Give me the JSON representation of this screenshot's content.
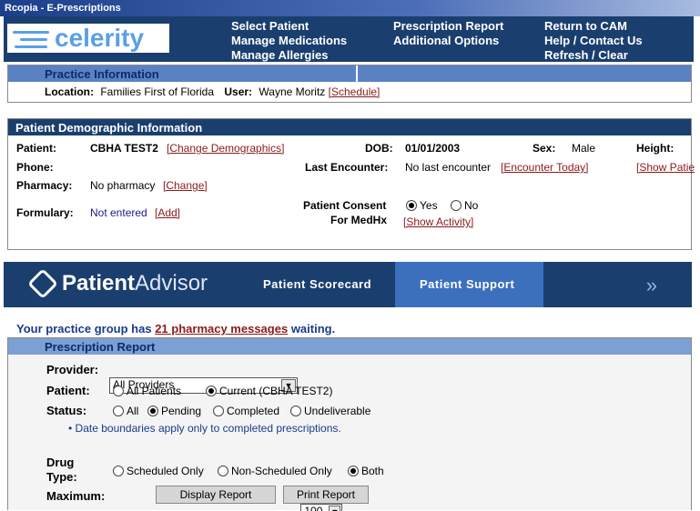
{
  "window": {
    "title": "Rcopia - E-Prescriptions"
  },
  "header": {
    "logo": "celerity",
    "nav": {
      "col1": [
        "Select Patient",
        "Manage Medications",
        "Manage Allergies"
      ],
      "col2": [
        "Prescription Report",
        "Additional Options"
      ],
      "col3": [
        "Return to CAM",
        "Help / Contact Us",
        "Refresh / Clear"
      ]
    }
  },
  "practice": {
    "heading": "Practice Information",
    "location_label": "Location:",
    "location": "Families First of Florida",
    "user_label": "User:",
    "user": "Wayne Moritz",
    "schedule_link": "[Schedule]"
  },
  "patient_demo": {
    "heading": "Patient Demographic Information",
    "patient_label": "Patient:",
    "patient": "CBHA TEST2",
    "change_demo_link": "[Change Demographics]",
    "dob_label": "DOB:",
    "dob": "01/01/2003",
    "sex_label": "Sex:",
    "sex": "Male",
    "height_label": "Height:",
    "phone_label": "Phone:",
    "last_enc_label": "Last Encounter:",
    "last_enc": "No last encounter",
    "enc_today_link": "[Encounter Today]",
    "show_patient_link": "[Show Patie",
    "pharmacy_label": "Pharmacy:",
    "pharmacy": "No pharmacy",
    "change_pharmacy_link": "[Change]",
    "consent_label_1": "Patient Consent",
    "consent_label_2": "For MedHx",
    "consent_yes": "Yes",
    "consent_no": "No",
    "show_activity_link": "[Show Activity]",
    "formulary_label": "Formulary:",
    "formulary": "Not entered",
    "add_link": "[Add]"
  },
  "patient_advisor": {
    "logo_bold": "Patient",
    "logo_light": "Advisor",
    "scorecard": "Patient Scorecard",
    "support": "Patient Support",
    "more": "»"
  },
  "messages": {
    "prefix": "Your practice group has",
    "link": "21 pharmacy messages",
    "suffix": "waiting."
  },
  "report": {
    "heading": "Prescription Report",
    "provider_label": "Provider:",
    "provider_value": "All Providers",
    "patient_label": "Patient:",
    "patient_opt_all": "All Patients",
    "patient_opt_current": "Current (CBHA TEST2)",
    "status_label": "Status:",
    "status_all": "All",
    "status_pending": "Pending",
    "status_completed": "Completed",
    "status_undeliverable": "Undeliverable",
    "note": "Date boundaries apply only to completed prescriptions.",
    "drug_label_1": "Drug",
    "drug_label_2": "Type:",
    "drug_scheduled": "Scheduled Only",
    "drug_nonscheduled": "Non-Scheduled Only",
    "drug_both": "Both",
    "maximum_label": "Maximum:",
    "maximum_value": "100",
    "display_button": "Display Report",
    "print_button": "Print Report"
  }
}
